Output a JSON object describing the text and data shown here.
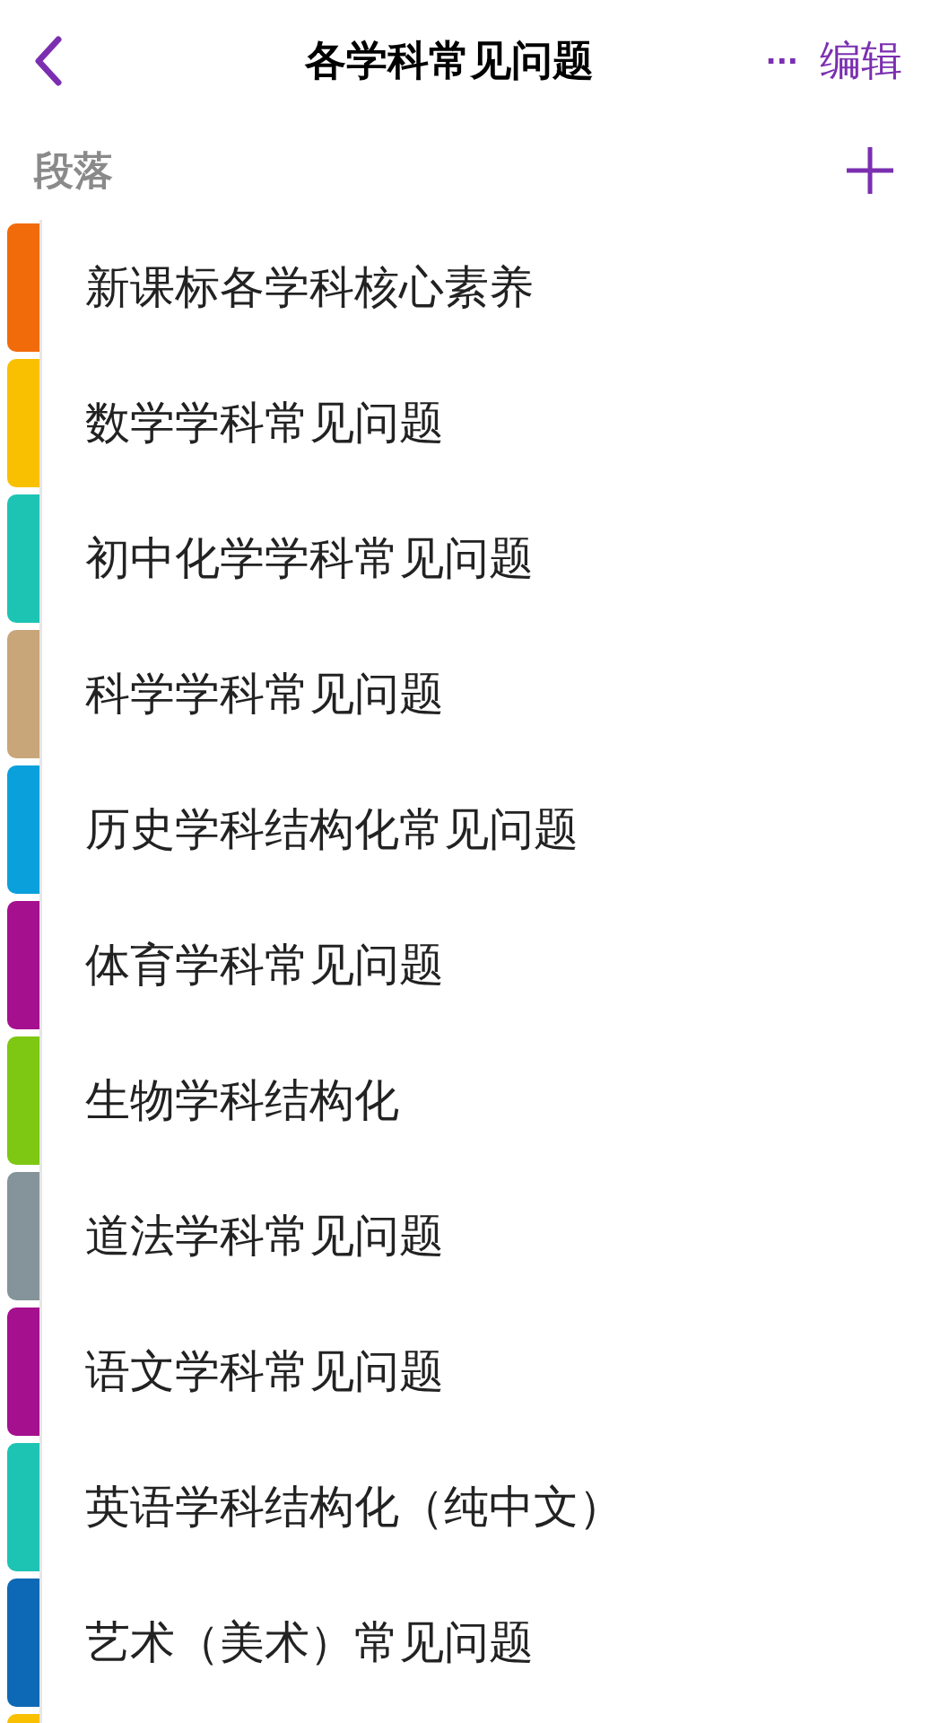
{
  "header": {
    "title": "各学科常见问题",
    "more": "···",
    "edit": "编辑"
  },
  "section_header": {
    "label": "段落"
  },
  "sections": [
    {
      "title": "新课标各学科核心素养",
      "color": "#f26b0a"
    },
    {
      "title": "数学学科常见问题",
      "color": "#f8c000"
    },
    {
      "title": "初中化学学科常见问题",
      "color": "#1dc4b4"
    },
    {
      "title": "科学学科常见问题",
      "color": "#c9a57a"
    },
    {
      "title": "历史学科结构化常见问题",
      "color": "#0aa0dc"
    },
    {
      "title": "体育学科常见问题",
      "color": "#a5108f"
    },
    {
      "title": "生物学科结构化",
      "color": "#7ec712"
    },
    {
      "title": "道法学科常见问题",
      "color": "#84949a"
    },
    {
      "title": "语文学科常见问题",
      "color": "#a5108f"
    },
    {
      "title": "英语学科结构化（纯中文）",
      "color": "#1dc4b4"
    },
    {
      "title": "艺术（美术）常见问题",
      "color": "#0d69b5"
    },
    {
      "color": "#f8c000"
    }
  ]
}
